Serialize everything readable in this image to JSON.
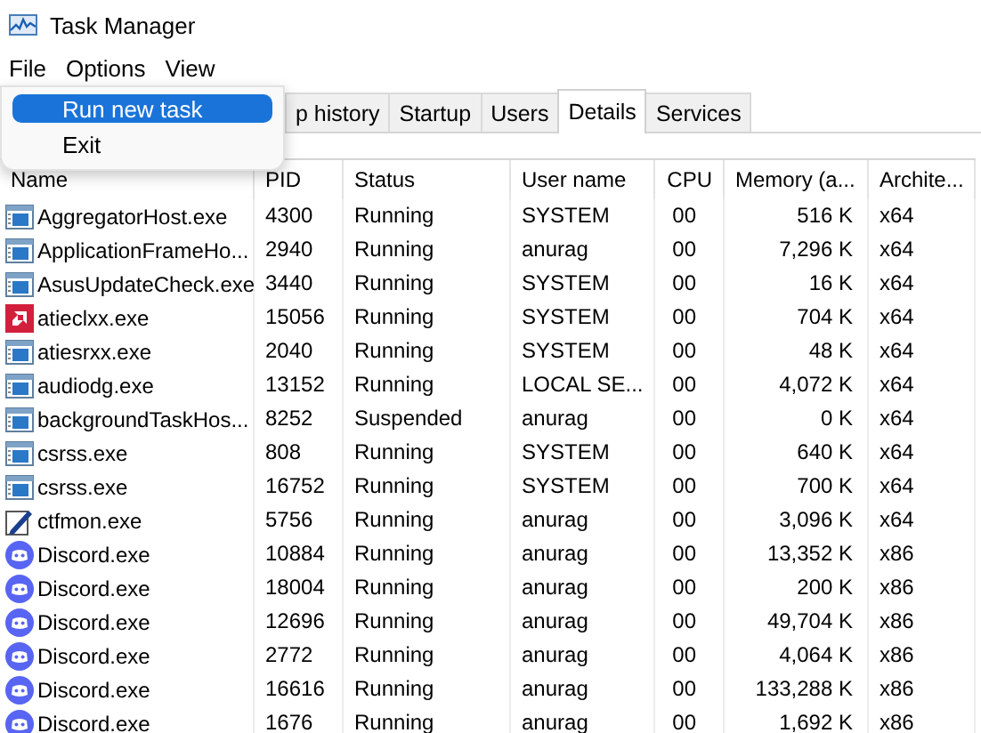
{
  "window": {
    "title": "Task Manager"
  },
  "menu_bar": [
    "File",
    "Options",
    "View"
  ],
  "file_menu": [
    {
      "label": "Run new task",
      "selected": true
    },
    {
      "label": "Exit",
      "selected": false
    }
  ],
  "tabs": [
    {
      "label": "p history",
      "selected": false
    },
    {
      "label": "Startup",
      "selected": false
    },
    {
      "label": "Users",
      "selected": false
    },
    {
      "label": "Details",
      "selected": true
    },
    {
      "label": "Services",
      "selected": false
    }
  ],
  "table": {
    "columns": [
      "Name",
      "PID",
      "Status",
      "User name",
      "CPU",
      "Memory (a...",
      "Archite..."
    ],
    "rows": [
      {
        "kind": "app",
        "cells": [
          "AggregatorHost.exe",
          "4300",
          "Running",
          "SYSTEM",
          "00",
          "516 K",
          "x64"
        ]
      },
      {
        "kind": "app",
        "cells": [
          "ApplicationFrameHo...",
          "2940",
          "Running",
          "anurag",
          "00",
          "7,296 K",
          "x64"
        ]
      },
      {
        "kind": "app",
        "cells": [
          "AsusUpdateCheck.exe",
          "3440",
          "Running",
          "SYSTEM",
          "00",
          "16 K",
          "x64"
        ]
      },
      {
        "kind": "amd",
        "cells": [
          "atieclxx.exe",
          "15056",
          "Running",
          "SYSTEM",
          "00",
          "704 K",
          "x64"
        ]
      },
      {
        "kind": "app",
        "cells": [
          "atiesrxx.exe",
          "2040",
          "Running",
          "SYSTEM",
          "00",
          "48 K",
          "x64"
        ]
      },
      {
        "kind": "app",
        "cells": [
          "audiodg.exe",
          "13152",
          "Running",
          "LOCAL SE...",
          "00",
          "4,072 K",
          "x64"
        ]
      },
      {
        "kind": "app",
        "cells": [
          "backgroundTaskHos...",
          "8252",
          "Suspended",
          "anurag",
          "00",
          "0 K",
          "x64"
        ]
      },
      {
        "kind": "app",
        "cells": [
          "csrss.exe",
          "808",
          "Running",
          "SYSTEM",
          "00",
          "640 K",
          "x64"
        ]
      },
      {
        "kind": "app",
        "cells": [
          "csrss.exe",
          "16752",
          "Running",
          "SYSTEM",
          "00",
          "700 K",
          "x64"
        ]
      },
      {
        "kind": "pen",
        "cells": [
          "ctfmon.exe",
          "5756",
          "Running",
          "anurag",
          "00",
          "3,096 K",
          "x64"
        ]
      },
      {
        "kind": "chat",
        "cells": [
          "Discord.exe",
          "10884",
          "Running",
          "anurag",
          "00",
          "13,352 K",
          "x86"
        ]
      },
      {
        "kind": "chat",
        "cells": [
          "Discord.exe",
          "18004",
          "Running",
          "anurag",
          "00",
          "200 K",
          "x86"
        ]
      },
      {
        "kind": "chat",
        "cells": [
          "Discord.exe",
          "12696",
          "Running",
          "anurag",
          "00",
          "49,704 K",
          "x86"
        ]
      },
      {
        "kind": "chat",
        "cells": [
          "Discord.exe",
          "2772",
          "Running",
          "anurag",
          "00",
          "4,064 K",
          "x86"
        ]
      },
      {
        "kind": "chat",
        "cells": [
          "Discord.exe",
          "16616",
          "Running",
          "anurag",
          "00",
          "133,288 K",
          "x86"
        ]
      },
      {
        "kind": "chat",
        "cells": [
          "Discord.exe",
          "1676",
          "Running",
          "anurag",
          "00",
          "1,692 K",
          "x86"
        ]
      }
    ]
  }
}
